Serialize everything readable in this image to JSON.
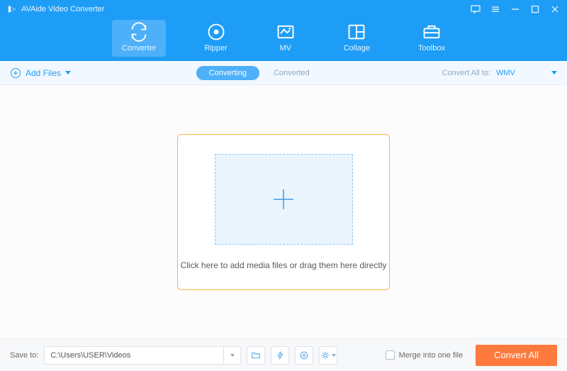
{
  "app": {
    "title": "AVAide Video Converter"
  },
  "nav": {
    "items": [
      {
        "label": "Converter",
        "icon": "converter-icon",
        "active": true
      },
      {
        "label": "Ripper",
        "icon": "ripper-icon",
        "active": false
      },
      {
        "label": "MV",
        "icon": "mv-icon",
        "active": false
      },
      {
        "label": "Collage",
        "icon": "collage-icon",
        "active": false
      },
      {
        "label": "Toolbox",
        "icon": "toolbox-icon",
        "active": false
      }
    ]
  },
  "toolbar": {
    "add_files_label": "Add Files",
    "tabs": {
      "converting": "Converting",
      "converted": "Converted"
    },
    "convert_all_label": "Convert All to:",
    "selected_format": "WMV"
  },
  "drop": {
    "hint": "Click here to add media files or drag them here directly"
  },
  "footer": {
    "save_label": "Save to:",
    "save_path": "C:\\Users\\USER\\Videos",
    "merge_label": "Merge into one file",
    "convert_button": "Convert All"
  }
}
